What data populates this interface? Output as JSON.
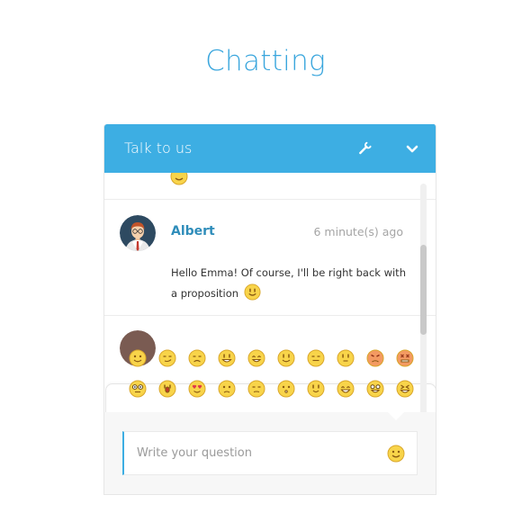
{
  "page": {
    "title": "Chatting"
  },
  "widget": {
    "title": "Talk to us",
    "header_icons": [
      "wrench-icon",
      "chevron-down-icon"
    ],
    "accent_color": "#3daee3"
  },
  "messages": [
    {
      "author": "Albert",
      "time": "6 minute(s) ago",
      "text": "Hello Emma! Of course, I'll be right back with a proposition",
      "trailing_emoji": "smile-emoji"
    }
  ],
  "emoji_panel": {
    "rows": [
      [
        "smile",
        "smirk",
        "frown",
        "grin",
        "laugh",
        "happy",
        "neutral",
        "flat",
        "angry",
        "furious"
      ],
      [
        "glasses",
        "shocked",
        "heart-eyes",
        "worried",
        "sad",
        "surprised",
        "blushing",
        "big-grin",
        "tongue",
        "squint"
      ]
    ]
  },
  "composer": {
    "placeholder": "Write your question",
    "emoji_button_icon": "smiley-icon"
  }
}
